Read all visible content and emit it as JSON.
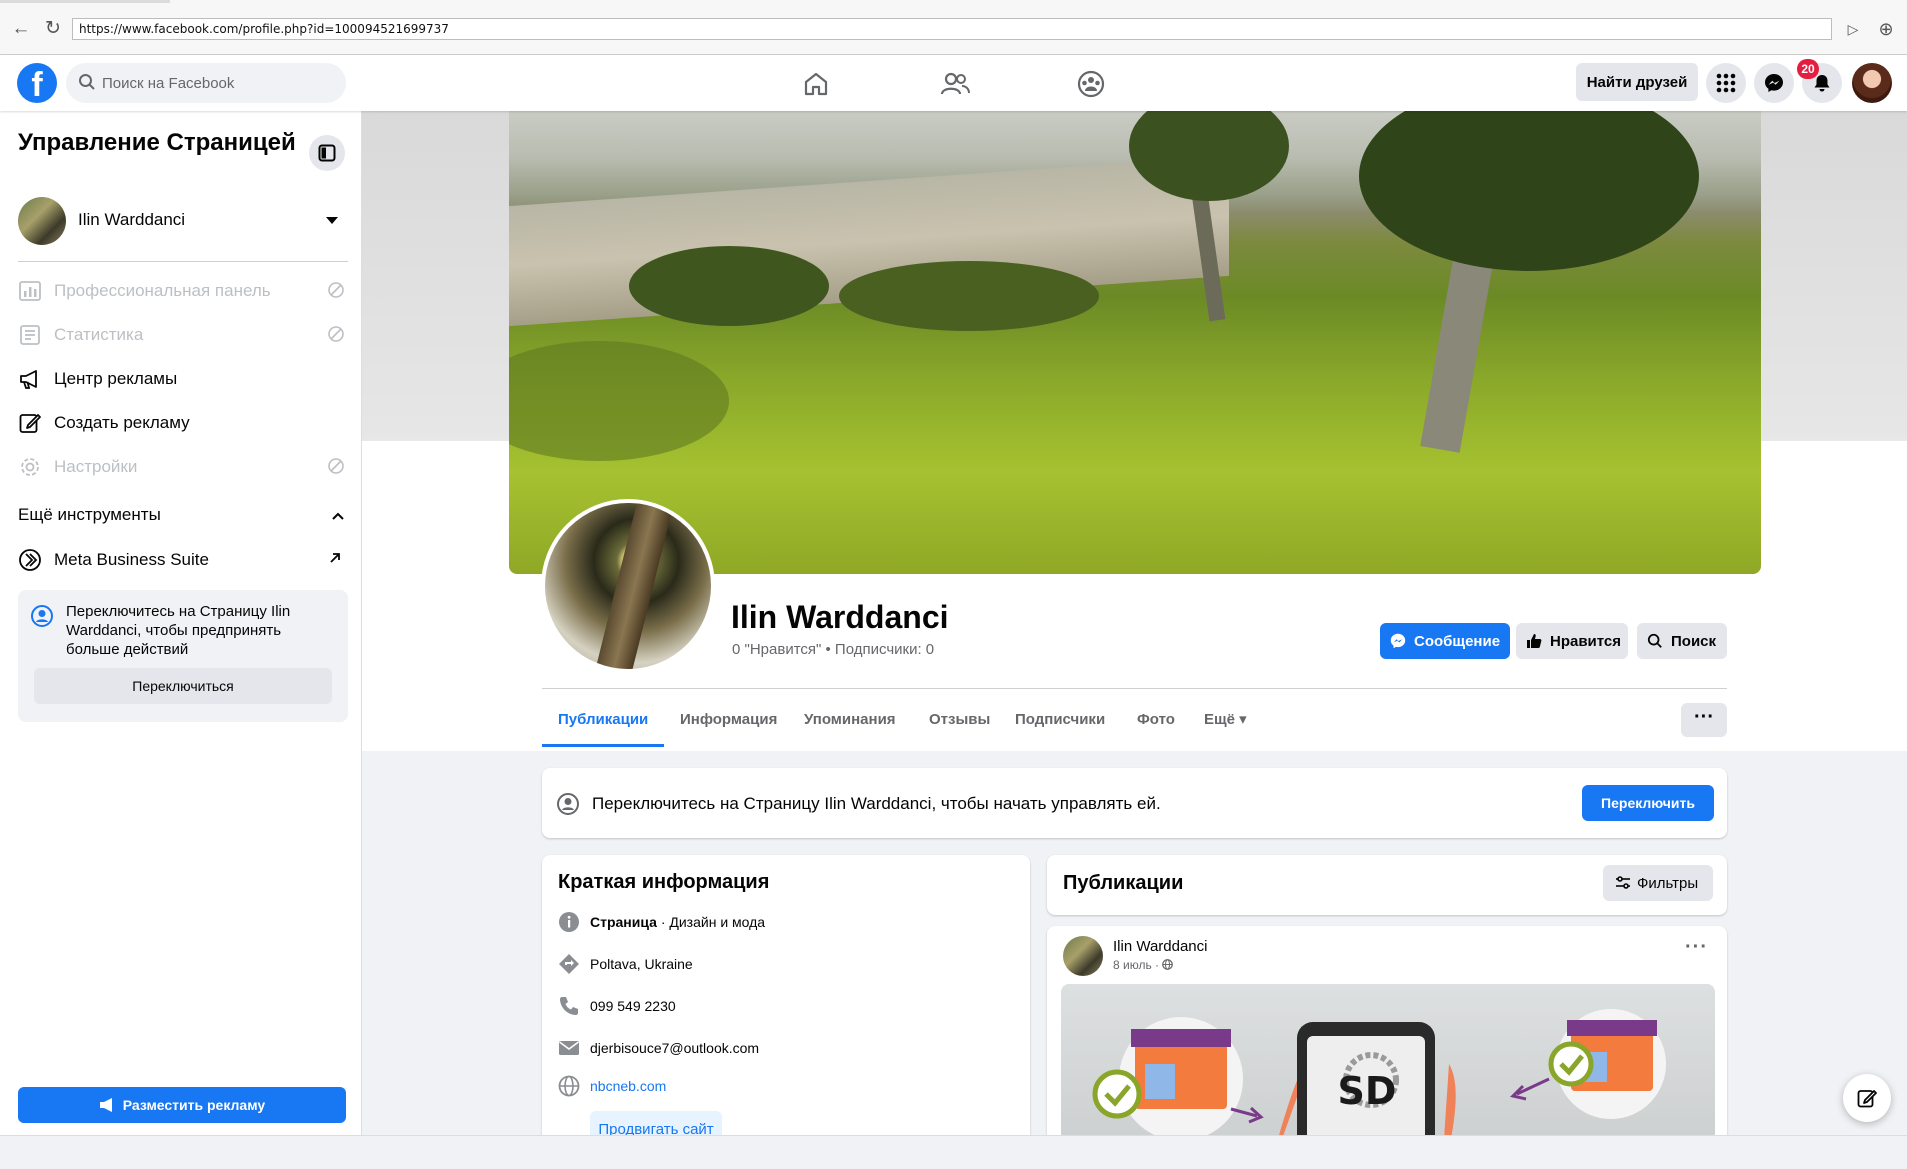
{
  "browser": {
    "url": "https://www.facebook.com/profile.php?id=100094521699737"
  },
  "header": {
    "logo_letter": "f",
    "search_placeholder": "Поиск на Facebook",
    "find_friends": "Найти друзей",
    "notifications_count": "20",
    "brand_color": "#1877f2"
  },
  "sidebar": {
    "title": "Управление Страницей",
    "page_name": "Ilin Warddanci",
    "items": [
      {
        "label": "Профессиональная панель",
        "icon": "dashboard-icon",
        "disabled": true
      },
      {
        "label": "Статистика",
        "icon": "stats-icon",
        "disabled": true
      },
      {
        "label": "Центр рекламы",
        "icon": "megaphone-icon",
        "disabled": false
      },
      {
        "label": "Создать рекламу",
        "icon": "edit-icon",
        "disabled": false
      },
      {
        "label": "Настройки",
        "icon": "gear-icon",
        "disabled": true
      }
    ],
    "more_tools": "Ещё инструменты",
    "meta_business_suite": "Meta Business Suite",
    "switch_text": "Переключитесь на Страницу Ilin Warddanci, чтобы предпринять больше действий",
    "switch_button": "Переключиться",
    "ad_button": "Разместить рекламу"
  },
  "profile": {
    "name": "Ilin Warddanci",
    "stats": "0 \"Нравится\" • Подписчики: 0",
    "message_button": "Сообщение",
    "like_button": "Нравится",
    "search_button": "Поиск"
  },
  "tabs": [
    {
      "label": "Публикации",
      "active": true
    },
    {
      "label": "Информация",
      "active": false
    },
    {
      "label": "Упоминания",
      "active": false
    },
    {
      "label": "Отзывы",
      "active": false
    },
    {
      "label": "Подписчики",
      "active": false
    },
    {
      "label": "Фото",
      "active": false
    },
    {
      "label": "Ещё ▾",
      "active": false
    }
  ],
  "more_dots": "···",
  "switch_banner": {
    "text": "Переключитесь на Страницу Ilin Warddanci, чтобы начать управлять ей.",
    "button": "Переключить"
  },
  "intro": {
    "title": "Краткая информация",
    "category_label": "Страница",
    "category_value": " · Дизайн и мода",
    "location": "Poltava, Ukraine",
    "phone": "099 549 2230",
    "email": "djerbisouce7@outlook.com",
    "website": "nbcneb.com",
    "promote_button": "Продвигать сайт"
  },
  "posts": {
    "title": "Публикации",
    "filters_button": "Фильтры",
    "post": {
      "author": "Ilin Warddanci",
      "date": "8 июль · ",
      "image_text": "SD"
    }
  }
}
